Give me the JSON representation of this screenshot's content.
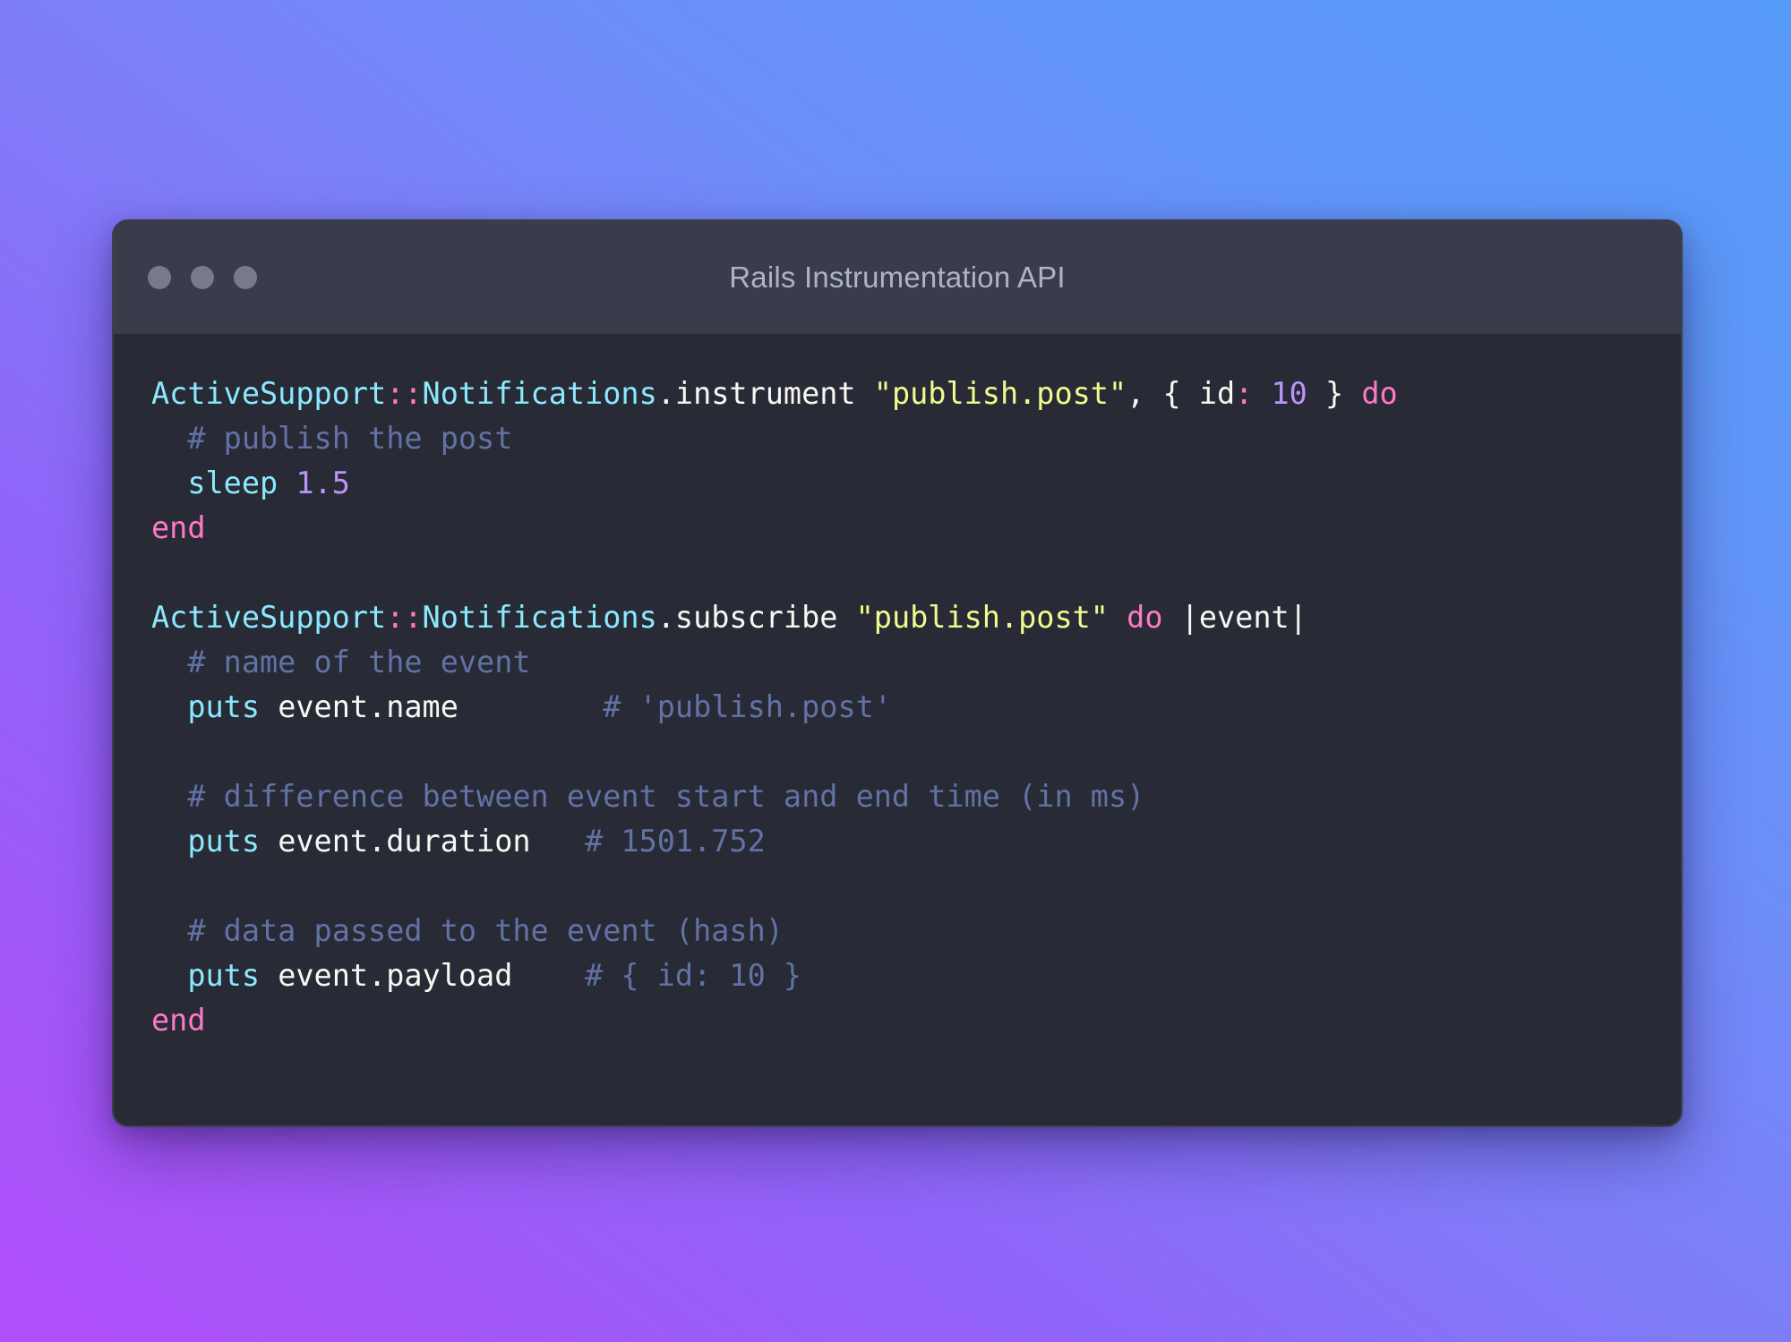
{
  "window": {
    "title": "Rails Instrumentation API",
    "traffic_lights": [
      {
        "name": "close",
        "color": "#767a8c"
      },
      {
        "name": "minimize",
        "color": "#767a8c"
      },
      {
        "name": "zoom",
        "color": "#767a8c"
      }
    ],
    "titlebar_color": "#393c4b",
    "body_color": "#282a36"
  },
  "backdrop": {
    "gradient_from": "#a556f8",
    "gradient_mid": "#7f7cf7",
    "gradient_to": "#569af8"
  },
  "theme": {
    "class_color": "#8be9fd",
    "keyword_color": "#ff79c6",
    "string_color": "#f1fa8c",
    "number_color": "#bd93f9",
    "comment_color": "#6272a4",
    "plain_color": "#f8f8f2"
  },
  "code": {
    "language": "ruby",
    "plain_text": "ActiveSupport::Notifications.instrument \"publish.post\", { id: 10 } do\n  # publish the post\n  sleep 1.5\nend\n\nActiveSupport::Notifications.subscribe \"publish.post\" do |event|\n  # name of the event\n  puts event.name        # 'publish.post'\n\n  # difference between event start and end time (in ms)\n  puts event.duration   # 1501.752\n\n  # data passed to the event (hash)\n  puts event.payload    # { id: 10 }\nend",
    "lines": [
      {
        "number": 1,
        "tokens": [
          {
            "t": "ActiveSupport",
            "c": "tok-class"
          },
          {
            "t": "::",
            "c": "tok-op"
          },
          {
            "t": "Notifications",
            "c": "tok-class"
          },
          {
            "t": ".instrument ",
            "c": "tok-plain"
          },
          {
            "t": "\"publish.post\"",
            "c": "tok-str"
          },
          {
            "t": ", { id",
            "c": "tok-plain"
          },
          {
            "t": ":",
            "c": "tok-op"
          },
          {
            "t": " ",
            "c": "tok-plain"
          },
          {
            "t": "10",
            "c": "tok-num"
          },
          {
            "t": " } ",
            "c": "tok-plain"
          },
          {
            "t": "do",
            "c": "tok-kw"
          }
        ]
      },
      {
        "number": 2,
        "tokens": [
          {
            "t": "  ",
            "c": "tok-plain"
          },
          {
            "t": "# publish the post",
            "c": "tok-comment"
          }
        ]
      },
      {
        "number": 3,
        "tokens": [
          {
            "t": "  ",
            "c": "tok-plain"
          },
          {
            "t": "sleep",
            "c": "tok-fn"
          },
          {
            "t": " ",
            "c": "tok-plain"
          },
          {
            "t": "1.5",
            "c": "tok-num"
          }
        ]
      },
      {
        "number": 4,
        "tokens": [
          {
            "t": "end",
            "c": "tok-kw"
          }
        ]
      },
      {
        "number": 5,
        "tokens": []
      },
      {
        "number": 6,
        "tokens": [
          {
            "t": "ActiveSupport",
            "c": "tok-class"
          },
          {
            "t": "::",
            "c": "tok-op"
          },
          {
            "t": "Notifications",
            "c": "tok-class"
          },
          {
            "t": ".subscribe ",
            "c": "tok-plain"
          },
          {
            "t": "\"publish.post\"",
            "c": "tok-str"
          },
          {
            "t": " ",
            "c": "tok-plain"
          },
          {
            "t": "do",
            "c": "tok-kw"
          },
          {
            "t": " |event|",
            "c": "tok-plain"
          }
        ]
      },
      {
        "number": 7,
        "tokens": [
          {
            "t": "  ",
            "c": "tok-plain"
          },
          {
            "t": "# name of the event",
            "c": "tok-comment"
          }
        ]
      },
      {
        "number": 8,
        "tokens": [
          {
            "t": "  ",
            "c": "tok-plain"
          },
          {
            "t": "puts",
            "c": "tok-fn"
          },
          {
            "t": " event.name        ",
            "c": "tok-plain"
          },
          {
            "t": "# 'publish.post'",
            "c": "tok-comment"
          }
        ]
      },
      {
        "number": 9,
        "tokens": []
      },
      {
        "number": 10,
        "tokens": [
          {
            "t": "  ",
            "c": "tok-plain"
          },
          {
            "t": "# difference between event start and end time (in ms)",
            "c": "tok-comment"
          }
        ]
      },
      {
        "number": 11,
        "tokens": [
          {
            "t": "  ",
            "c": "tok-plain"
          },
          {
            "t": "puts",
            "c": "tok-fn"
          },
          {
            "t": " event.duration   ",
            "c": "tok-plain"
          },
          {
            "t": "# 1501.752",
            "c": "tok-comment"
          }
        ]
      },
      {
        "number": 12,
        "tokens": []
      },
      {
        "number": 13,
        "tokens": [
          {
            "t": "  ",
            "c": "tok-plain"
          },
          {
            "t": "# data passed to the event (hash)",
            "c": "tok-comment"
          }
        ]
      },
      {
        "number": 14,
        "tokens": [
          {
            "t": "  ",
            "c": "tok-plain"
          },
          {
            "t": "puts",
            "c": "tok-fn"
          },
          {
            "t": " event.payload    ",
            "c": "tok-plain"
          },
          {
            "t": "# { id: 10 }",
            "c": "tok-comment"
          }
        ]
      },
      {
        "number": 15,
        "tokens": [
          {
            "t": "end",
            "c": "tok-kw"
          }
        ]
      }
    ]
  }
}
